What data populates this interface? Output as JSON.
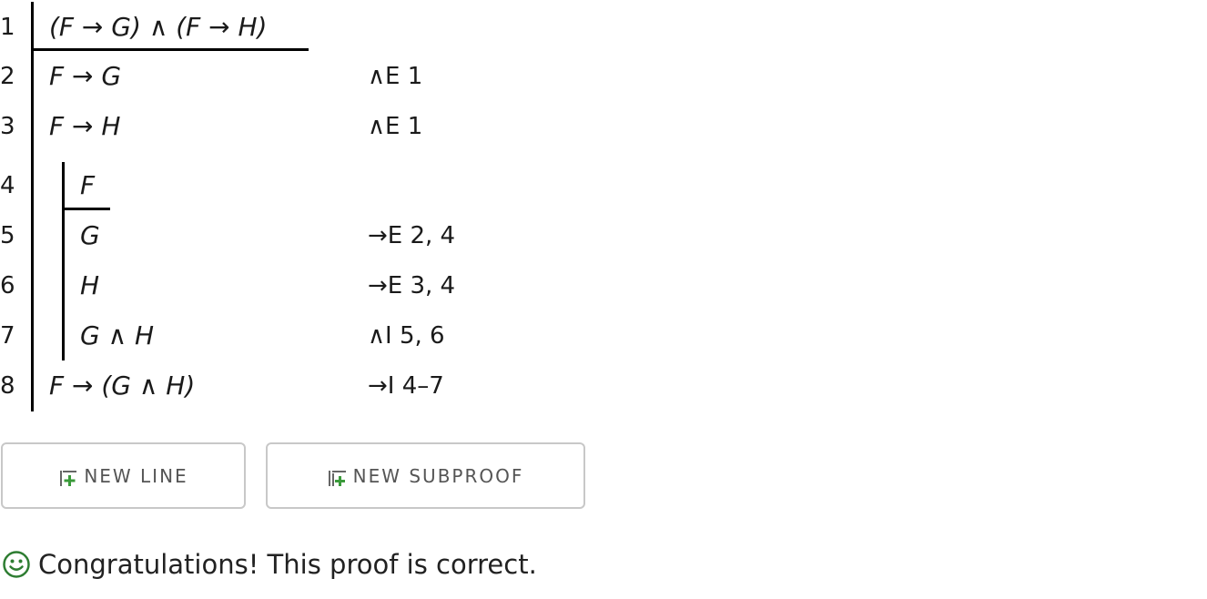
{
  "proof": {
    "lines": [
      {
        "num": "1",
        "formula": "(F → G) ∧ (F → H)",
        "justification": ""
      },
      {
        "num": "2",
        "formula": "F → G",
        "justification": "∧E 1"
      },
      {
        "num": "3",
        "formula": "F → H",
        "justification": "∧E 1"
      },
      {
        "num": "4",
        "formula": "F",
        "justification": ""
      },
      {
        "num": "5",
        "formula": "G",
        "justification": "→E 2, 4"
      },
      {
        "num": "6",
        "formula": "H",
        "justification": "→E 3, 4"
      },
      {
        "num": "7",
        "formula": "G ∧ H",
        "justification": "∧I 5, 6"
      },
      {
        "num": "8",
        "formula": "F → (G ∧ H)",
        "justification": "→I 4–7"
      }
    ]
  },
  "toolbar": {
    "new_line_label": "NEW LINE",
    "new_subproof_label": "NEW SUBPROOF",
    "new_line_icon": "add-line-icon",
    "new_subproof_icon": "add-subproof-icon"
  },
  "status": {
    "icon": "smiley-icon",
    "message": "Congratulations! This proof is correct.",
    "icon_color": "#2e7d32"
  }
}
